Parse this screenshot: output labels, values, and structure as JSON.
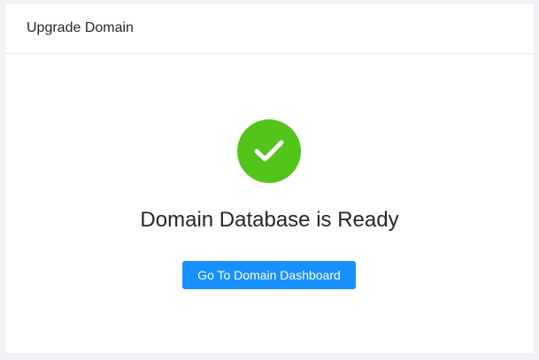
{
  "header": {
    "title": "Upgrade Domain"
  },
  "result": {
    "status": "success",
    "icon": "check-circle-icon",
    "title": "Domain Database is Ready",
    "action_label": "Go To Domain Dashboard"
  },
  "colors": {
    "success": "#52c41a",
    "primary": "#1890ff"
  }
}
